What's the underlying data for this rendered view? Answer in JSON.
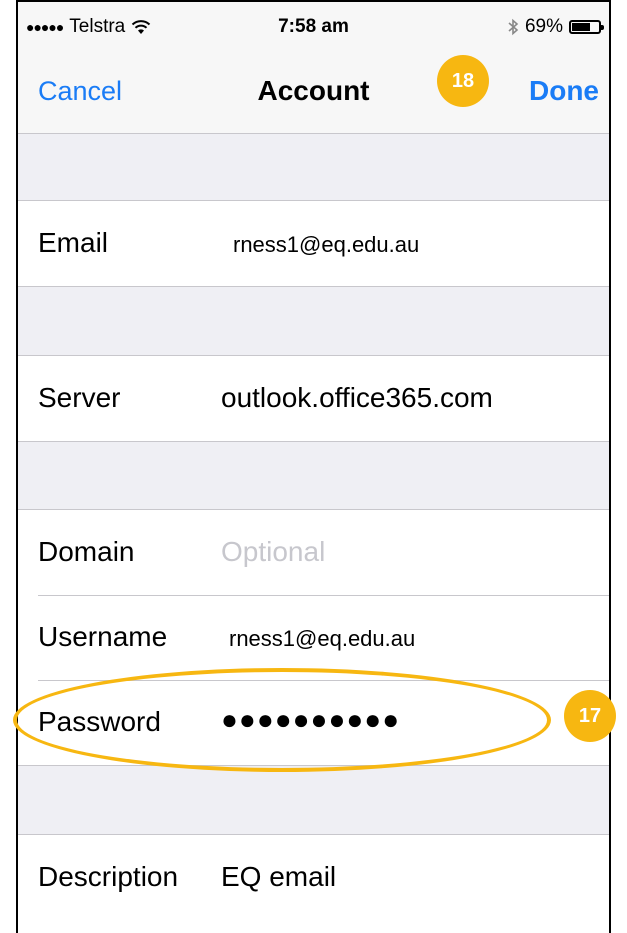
{
  "status": {
    "carrier": "Telstra",
    "signal_dots": "●●●●●",
    "time": "7:58 am",
    "battery": "69%",
    "battery_level": 0.69
  },
  "nav": {
    "cancel": "Cancel",
    "title": "Account",
    "done": "Done"
  },
  "fields": {
    "email": {
      "label": "Email",
      "value": "rness1@eq.edu.au"
    },
    "server": {
      "label": "Server",
      "value": "outlook.office365.com"
    },
    "domain": {
      "label": "Domain",
      "placeholder": "Optional"
    },
    "username": {
      "label": "Username",
      "value": "rness1@eq.edu.au"
    },
    "password": {
      "label": "Password",
      "value": "●●●●●●●●●●"
    },
    "description": {
      "label": "Description",
      "value": "EQ email"
    }
  },
  "annotations": {
    "done_step": "18",
    "password_step": "17"
  },
  "colors": {
    "accent": "#1a7cf6",
    "annotation": "#f7b711"
  }
}
